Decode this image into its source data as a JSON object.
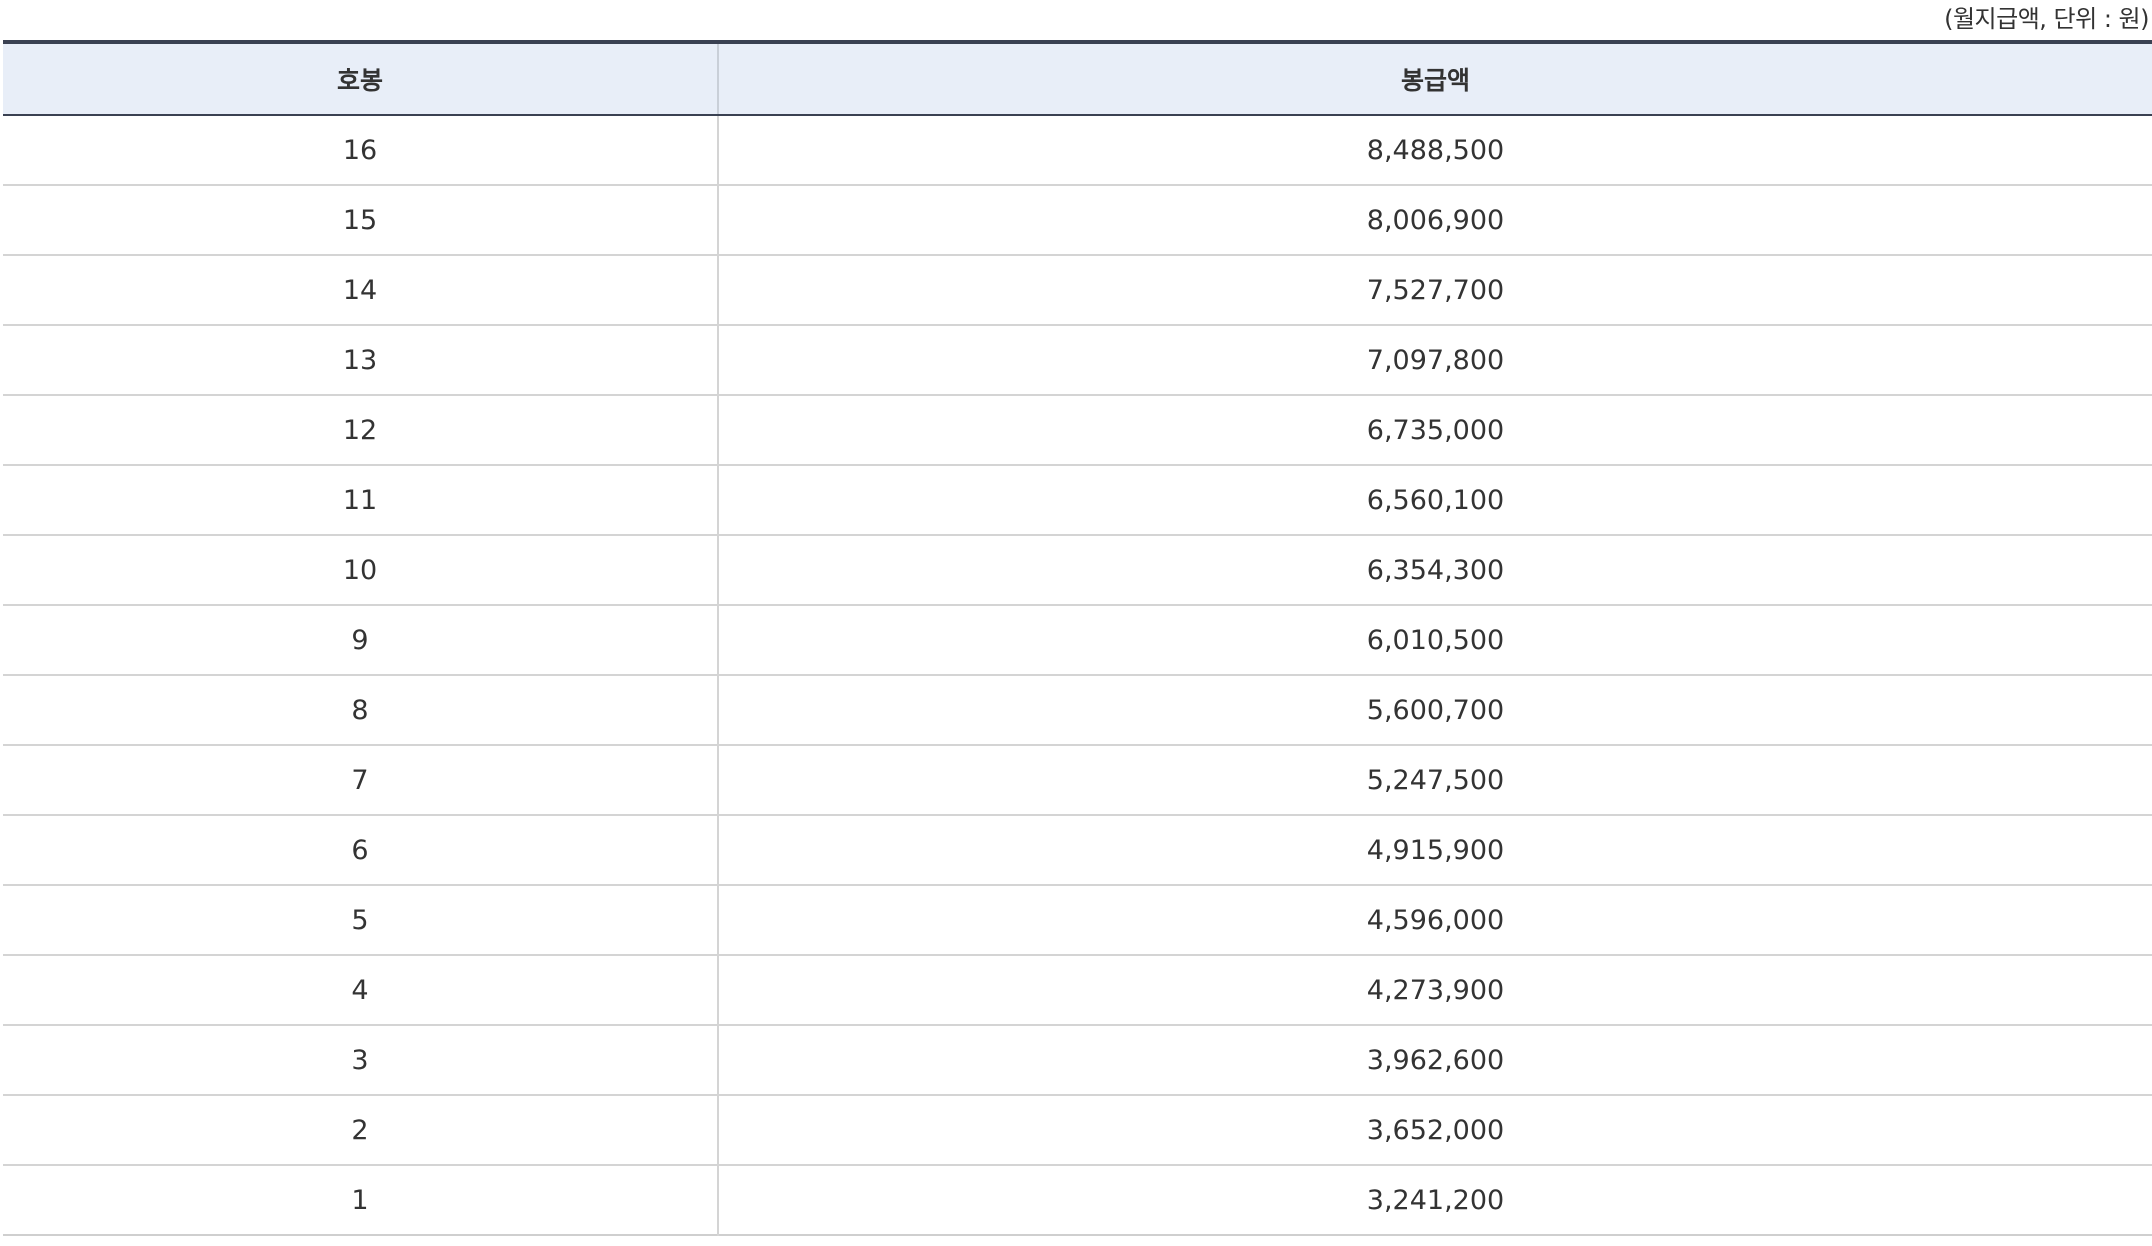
{
  "unit_note": "(월지급액, 단위 : 원)",
  "table": {
    "headers": [
      "호봉",
      "봉급액"
    ],
    "rows": [
      {
        "grade": "16",
        "amount": "8,488,500"
      },
      {
        "grade": "15",
        "amount": "8,006,900"
      },
      {
        "grade": "14",
        "amount": "7,527,700"
      },
      {
        "grade": "13",
        "amount": "7,097,800"
      },
      {
        "grade": "12",
        "amount": "6,735,000"
      },
      {
        "grade": "11",
        "amount": "6,560,100"
      },
      {
        "grade": "10",
        "amount": "6,354,300"
      },
      {
        "grade": "9",
        "amount": "6,010,500"
      },
      {
        "grade": "8",
        "amount": "5,600,700"
      },
      {
        "grade": "7",
        "amount": "5,247,500"
      },
      {
        "grade": "6",
        "amount": "4,915,900"
      },
      {
        "grade": "5",
        "amount": "4,596,000"
      },
      {
        "grade": "4",
        "amount": "4,273,900"
      },
      {
        "grade": "3",
        "amount": "3,962,600"
      },
      {
        "grade": "2",
        "amount": "3,652,000"
      },
      {
        "grade": "1",
        "amount": "3,241,200"
      }
    ]
  }
}
